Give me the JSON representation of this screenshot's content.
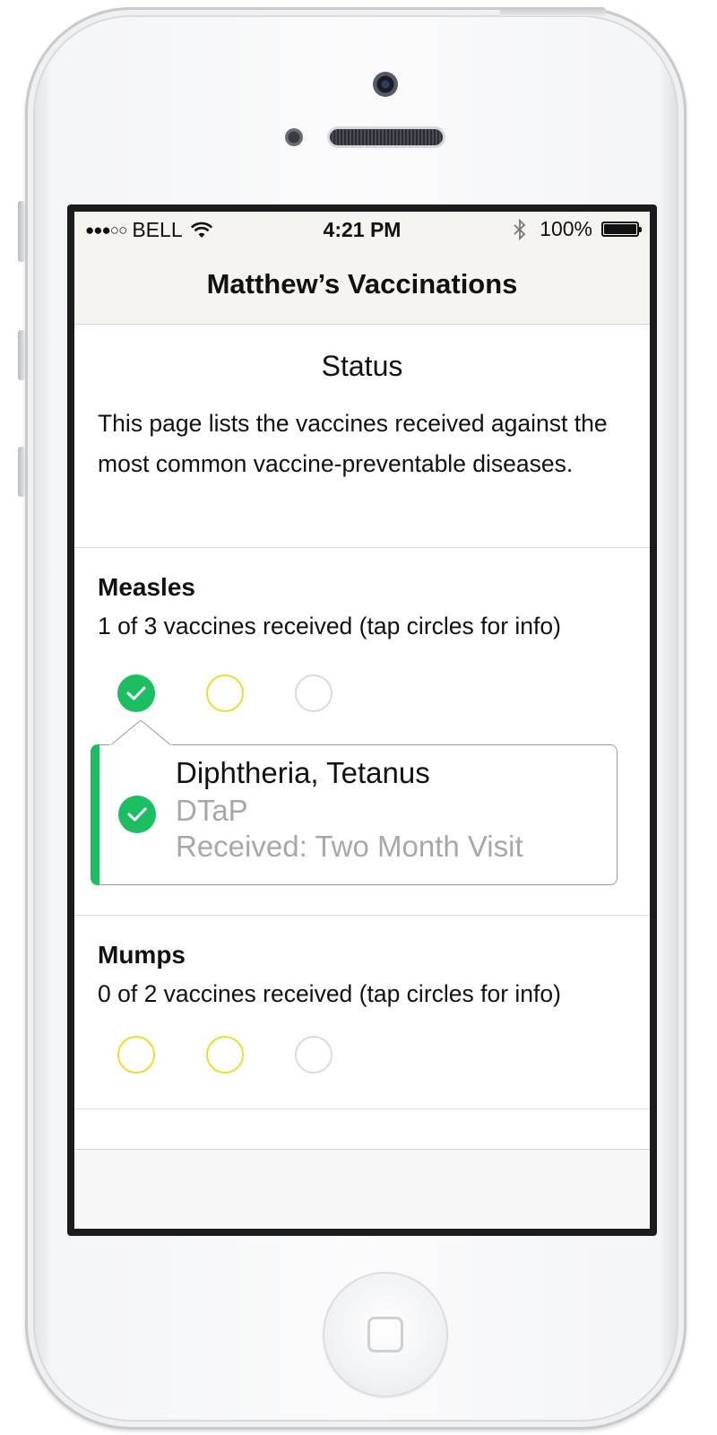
{
  "status_bar": {
    "signal_dots": "●●●○○",
    "carrier": "BELL",
    "time": "4:21 PM",
    "battery": "100%",
    "battery_level": 1.0
  },
  "nav": {
    "title": "Matthew’s Vaccinations"
  },
  "intro": {
    "heading": "Status",
    "text": "This page lists the vaccines received against the most common vaccine-preventable diseases."
  },
  "sections": [
    {
      "title": "Measles",
      "subtitle": "1 of 3 vaccines received (tap circles for info)",
      "doses": [
        "received",
        "pending",
        "empty"
      ],
      "popover": {
        "name": "Diphtheria, Tetanus",
        "code": "DTaP",
        "received": "Received: Two Month Visit"
      }
    },
    {
      "title": "Mumps",
      "subtitle": "0 of 2 vaccines received (tap circles for info)",
      "doses": [
        "pending",
        "pending",
        "empty"
      ]
    }
  ],
  "colors": {
    "received": "#1bbf62",
    "pending": "#e9df2e",
    "empty": "#dcdbd6",
    "bar_background": "#f5f4f1"
  },
  "icons": {
    "wifi": "wifi-icon",
    "bluetooth": "bluetooth-icon",
    "battery": "battery-icon",
    "check": "checkmark-icon"
  }
}
